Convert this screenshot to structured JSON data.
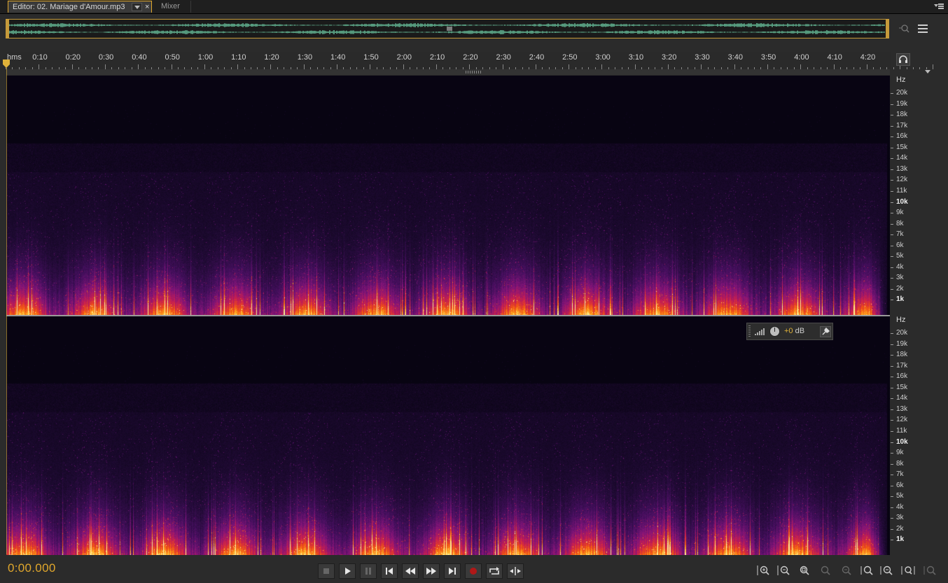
{
  "tabs": {
    "editor_label": "Editor: 02. Mariage d'Amour.mp3",
    "close_label": "×",
    "mixer_label": "Mixer"
  },
  "timeline": {
    "unit_label": "hms",
    "labels": [
      "0:10",
      "0:20",
      "0:30",
      "0:40",
      "0:50",
      "1:00",
      "1:10",
      "1:20",
      "1:30",
      "1:40",
      "1:50",
      "2:00",
      "2:10",
      "2:20",
      "2:30",
      "2:40",
      "2:50",
      "3:00",
      "3:10",
      "3:20",
      "3:30",
      "3:40",
      "3:50",
      "4:00",
      "4:10",
      "4:20"
    ]
  },
  "frequency_ruler": {
    "unit_label": "Hz",
    "labels": [
      "20k",
      "19k",
      "18k",
      "17k",
      "16k",
      "15k",
      "14k",
      "13k",
      "12k",
      "11k",
      "10k",
      "9k",
      "8k",
      "7k",
      "6k",
      "5k",
      "4k",
      "3k",
      "2k",
      "1k"
    ],
    "bold_labels": [
      "10k",
      "1k"
    ]
  },
  "hud": {
    "gain_value": "+0",
    "gain_unit": " dB"
  },
  "transport": {
    "current_time": "0:00.000"
  },
  "icons": {
    "stop": "stop-icon",
    "play": "play-icon",
    "pause": "pause-icon",
    "prev": "skip-to-start-icon",
    "rewind": "rewind-icon",
    "ffwd": "fast-forward-icon",
    "next": "skip-to-end-icon",
    "record": "record-icon",
    "loop": "loop-icon",
    "skip": "skip-selection-icon",
    "headphones": "headphones-icon"
  },
  "colors": {
    "accent": "#e0a72c",
    "waveform": "#6fd0a8",
    "record": "#b01818"
  }
}
